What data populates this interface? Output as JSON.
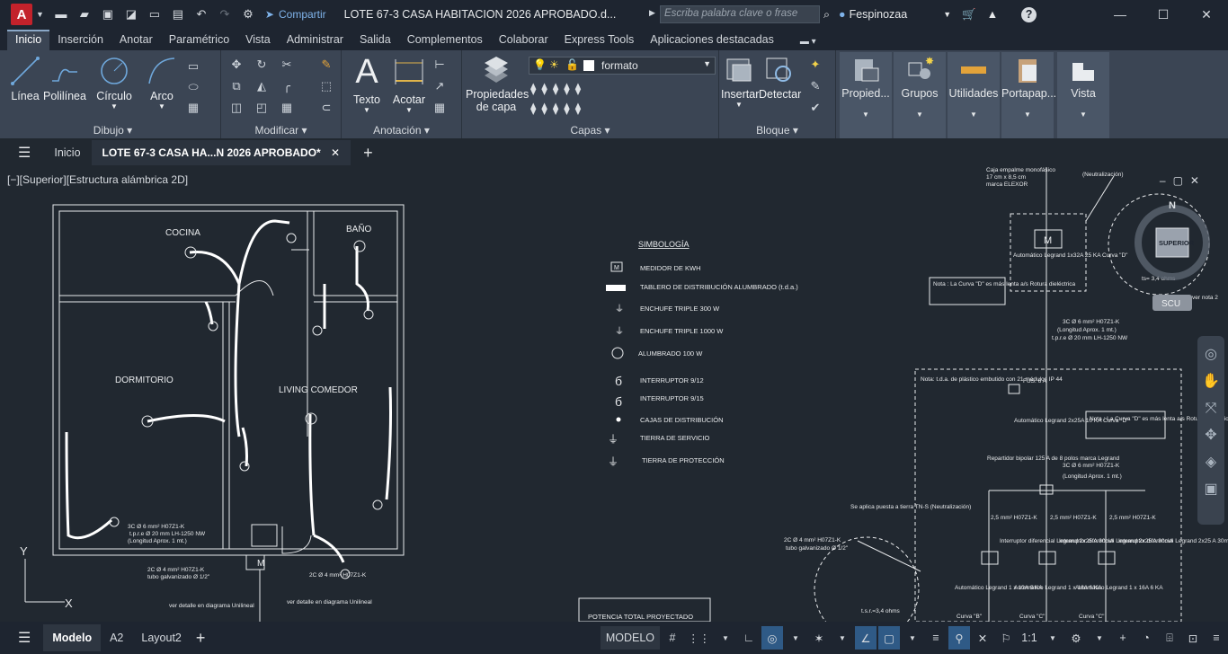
{
  "app": {
    "logo": "A",
    "share": "Compartir",
    "doc_title": "LOTE 67-3 CASA HABITACION 2026 APROBADO.d...",
    "search_placeholder": "Escriba palabra clave o frase",
    "user": "Fespinozaa"
  },
  "ribbon_tabs": [
    "Inicio",
    "Inserción",
    "Anotar",
    "Paramétrico",
    "Vista",
    "Administrar",
    "Salida",
    "Complementos",
    "Colaborar",
    "Express Tools",
    "Aplicaciones destacadas"
  ],
  "ribbon": {
    "draw": {
      "line": "Línea",
      "polyline": "Polilínea",
      "circle": "Círculo",
      "arc": "Arco",
      "title": "Dibujo"
    },
    "modify": {
      "title": "Modificar"
    },
    "annotation": {
      "text": "Texto",
      "dim": "Acotar",
      "title": "Anotación"
    },
    "layers": {
      "props": "Propiedades de capa",
      "current_layer": "formato",
      "title": "Capas"
    },
    "block": {
      "insert": "Insertar",
      "detect": "Detectar",
      "title": "Bloque"
    },
    "props": "Propied...",
    "groups": "Grupos",
    "utils": "Utilidades",
    "clipboard": "Portapap...",
    "view": "Vista"
  },
  "file_tabs": {
    "home": "Inicio",
    "active": "LOTE 67-3 CASA HA...N 2026 APROBADO*"
  },
  "viewport_label": "[−][Superior][Estructura alámbrica 2D]",
  "drawing": {
    "rooms": {
      "kitchen": "COCINA",
      "bath": "BAÑO",
      "bedroom": "DORMITORIO",
      "living": "LIVING COMEDOR"
    },
    "legend": {
      "title": "SIMBOLOGÍA",
      "items": [
        "MEDIDOR DE KWH",
        "TABLERO DE DISTRIBUCIÓN ALUMBRADO (t.d.a.)",
        "ENCHUFE TRIPLE 300 W",
        "ENCHUFE TRIPLE 1000 W",
        "ALUMBRADO 100 W",
        "INTERRUPTOR 9/12",
        "INTERRUPTOR 9/15",
        "CAJAS DE DISTRIBUCIÓN",
        "TIERRA DE SERVICIO",
        "TIERRA DE PROTECCIÓN"
      ]
    },
    "potencia": "POTENCIA  TOTAL PROYECTADO",
    "cable_note": [
      "3C Ø 6 mm² H07Z1-K",
      "t.p.r.e Ø 20 mm LH-1250 NW",
      "(Longitud Aprox. 1 mt.)"
    ],
    "viewcube": {
      "top": "SUPERIOR",
      "n": "N",
      "ucs": "SCU"
    },
    "diagram_notes": [
      "Caja empalme monofásico",
      "17 cm x 8,5 cm",
      "marca ELEXOR",
      "Automático Legrand 1x32A 25 KA Curva \"D\"",
      "Nota : La Curva \"D\" es más lenta a/s Rotura dieléctrica",
      "3C Ø 6 mm² H07Z1-K",
      "(Longitud Aprox. 1 mt.)",
      "t.p.r.e Ø 20 mm LH-1250 NW",
      "Nota: t.d.a. de plástico embutido con 21 módulos IP 44",
      "FUS. 6 A",
      "Automático Legrand 2x25A 10 KA Curva \"D\"",
      "Repartidor bipolar 125 A de 8 polos marca Legrand",
      "2,5 mm² H07Z1-K",
      "Interruptor diferencial Legrand 2x25 A 30mA",
      "Automático Legrand 1 x 10A 6 KA",
      "Automático Legrand 1 x 16A 6 KA",
      "Se aplica puesta a tierra TN-S (Neutralización)",
      "2C Ø 4 mm² H07Z1-K",
      "tubo galvanizado Ø 1/2\"",
      "ver detalle en diagrama Unilineal",
      "(Neutralización)",
      "ver nota 2",
      "t.s.r.=3,4 ohms",
      "ts= 3,4 ohms",
      "Curva \"B\"",
      "Curva \"C\""
    ]
  },
  "layout_tabs": [
    "Modelo",
    "A2",
    "Layout2"
  ],
  "status": {
    "model": "MODELO",
    "scale": "1:1"
  }
}
